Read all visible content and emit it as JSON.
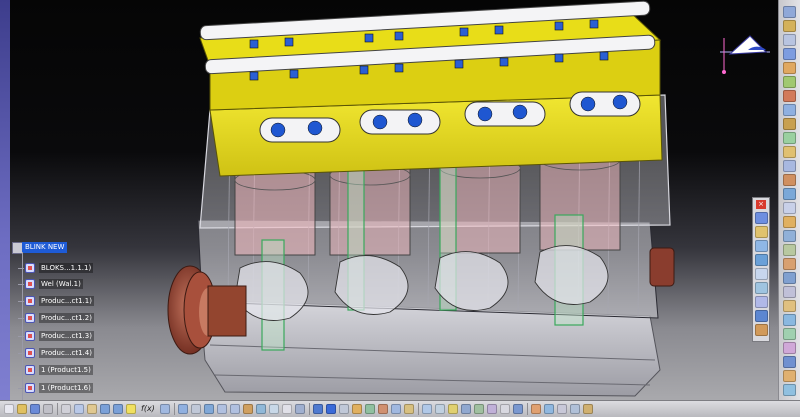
{
  "spec_tree": {
    "root_label": "BLINK NEW",
    "items": [
      "BLOKS...1.1.1)",
      "Wel (Wal.1)",
      "Produc...ct1.1)",
      "Produc...ct1.2)",
      "Produc...ct1.3)",
      "Produc...ct1.4)",
      "1 (Product1.5)",
      "1 (Product1.6)"
    ]
  },
  "palette": {
    "close_label": "×"
  },
  "bottom_toolbar": {
    "formula_label": "f(x)"
  },
  "colors": {
    "cylinder_head": "#e8dd18",
    "crank_flange": "#8a3d2e",
    "selection": "#1e5bd6",
    "block_wireframe": "#dcdce2"
  },
  "icons": {
    "right_toolbar": [
      "save-icon",
      "lock-icon",
      "plane-icon",
      "sketch-icon",
      "pad-icon",
      "pocket-icon",
      "shaft-icon",
      "groove-icon",
      "hole-icon",
      "rib-icon",
      "slot-icon",
      "stiffener-icon",
      "loft-icon",
      "fillet-icon",
      "chamfer-icon",
      "draft-icon",
      "shell-icon",
      "thickness-icon",
      "thread-icon",
      "split-icon",
      "remove-icon",
      "union-icon",
      "pattern-icon",
      "mirror-icon",
      "scale-icon",
      "transform-icon",
      "measure-icon",
      "constraint-icon",
      "analysis-icon",
      "update-icon"
    ],
    "palette": [
      "scissors-icon",
      "pencil-icon",
      "line-icon",
      "axis-icon",
      "point-icon",
      "spline-icon",
      "arc-icon",
      "circle-icon",
      "project-icon",
      "offset-icon",
      "trim-icon",
      "corner-icon"
    ],
    "bottom_toolbar": [
      "new-icon",
      "open-icon",
      "save-icon",
      "print-icon",
      "cut-icon",
      "copy-icon",
      "paste-icon",
      "undo-icon",
      "redo-icon",
      "help-icon",
      "formula-icon",
      "catalog-icon",
      "compass-icon",
      "pan-icon",
      "rotate-icon",
      "zoom-in-icon",
      "zoom-out-icon",
      "normal-view-icon",
      "views-icon",
      "render-icon",
      "hide-icon",
      "swap-icon",
      "axis-icon",
      "measure-icon",
      "snap-icon",
      "constraint-icon",
      "manip-icon",
      "explode-icon",
      "clash-icon",
      "section-icon",
      "scene-icon",
      "render-style-icon",
      "light-icon",
      "camera-icon",
      "walk-icon",
      "fly-icon",
      "grid-icon",
      "measure-item-icon",
      "analysis-icon",
      "material-icon",
      "publish-icon",
      "settings-icon",
      "last-icon"
    ]
  }
}
